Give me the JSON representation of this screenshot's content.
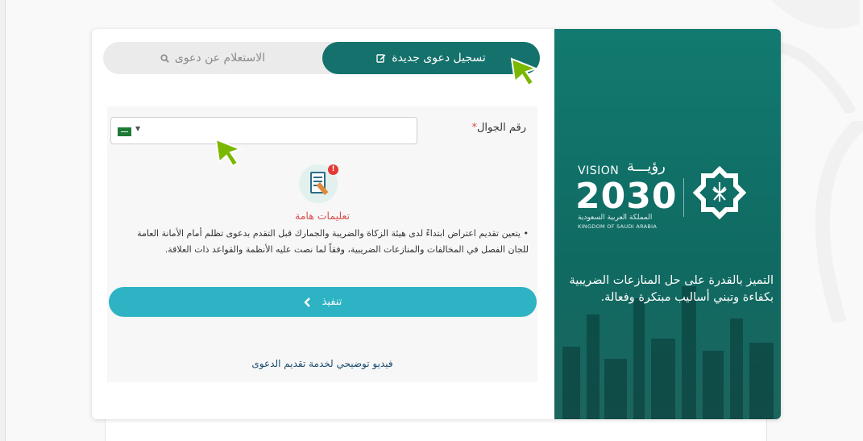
{
  "tabs": {
    "new_claim": "تسجيل دعوى جديدة",
    "inquiry": "الاستعلام عن دعوى"
  },
  "form": {
    "phone_label": "رقم الجوال",
    "required_mark": "*",
    "phone_value": "",
    "country_flag": "saudi-arabia-flag"
  },
  "instructions": {
    "title": "تعليمات هامة",
    "bullet": "•",
    "text": "يتعين تقديم اعتراض ابتداءً لدى هيئة الزكاة والضريبة والجمارك قبل التقدم بدعوى تظلم أمام الأمانة العامة للجان الفصل في المخالفات والمنازعات الضريبية، وفقاً لما نصت عليه الأنظمة والقواعد ذات العلاقة.",
    "badge": "!"
  },
  "actions": {
    "submit": "تنفيذ",
    "submit_arrow": "‹",
    "video_link": "فيديو توضيحي لخدمة تقديم الدعوى"
  },
  "banner": {
    "vision_en": "VISION",
    "vision_ar": "رؤيـــة",
    "year": "2030",
    "kingdom_ar": "المملكة العربية السعودية",
    "kingdom_en": "KINGDOM OF SAUDI ARABIA",
    "slogan": "التميز بالقدرة على حل المنازعات الضريبية بكفاءة وتبني أساليب مبتكرة وفعالة."
  },
  "colors": {
    "primary": "#14716b",
    "button": "#2db3c4",
    "required": "#d9534f",
    "cursor": "#7ab800"
  },
  "icons": {
    "edit": "edit-icon",
    "search": "search-icon",
    "chevron": "chevron-left-icon"
  }
}
